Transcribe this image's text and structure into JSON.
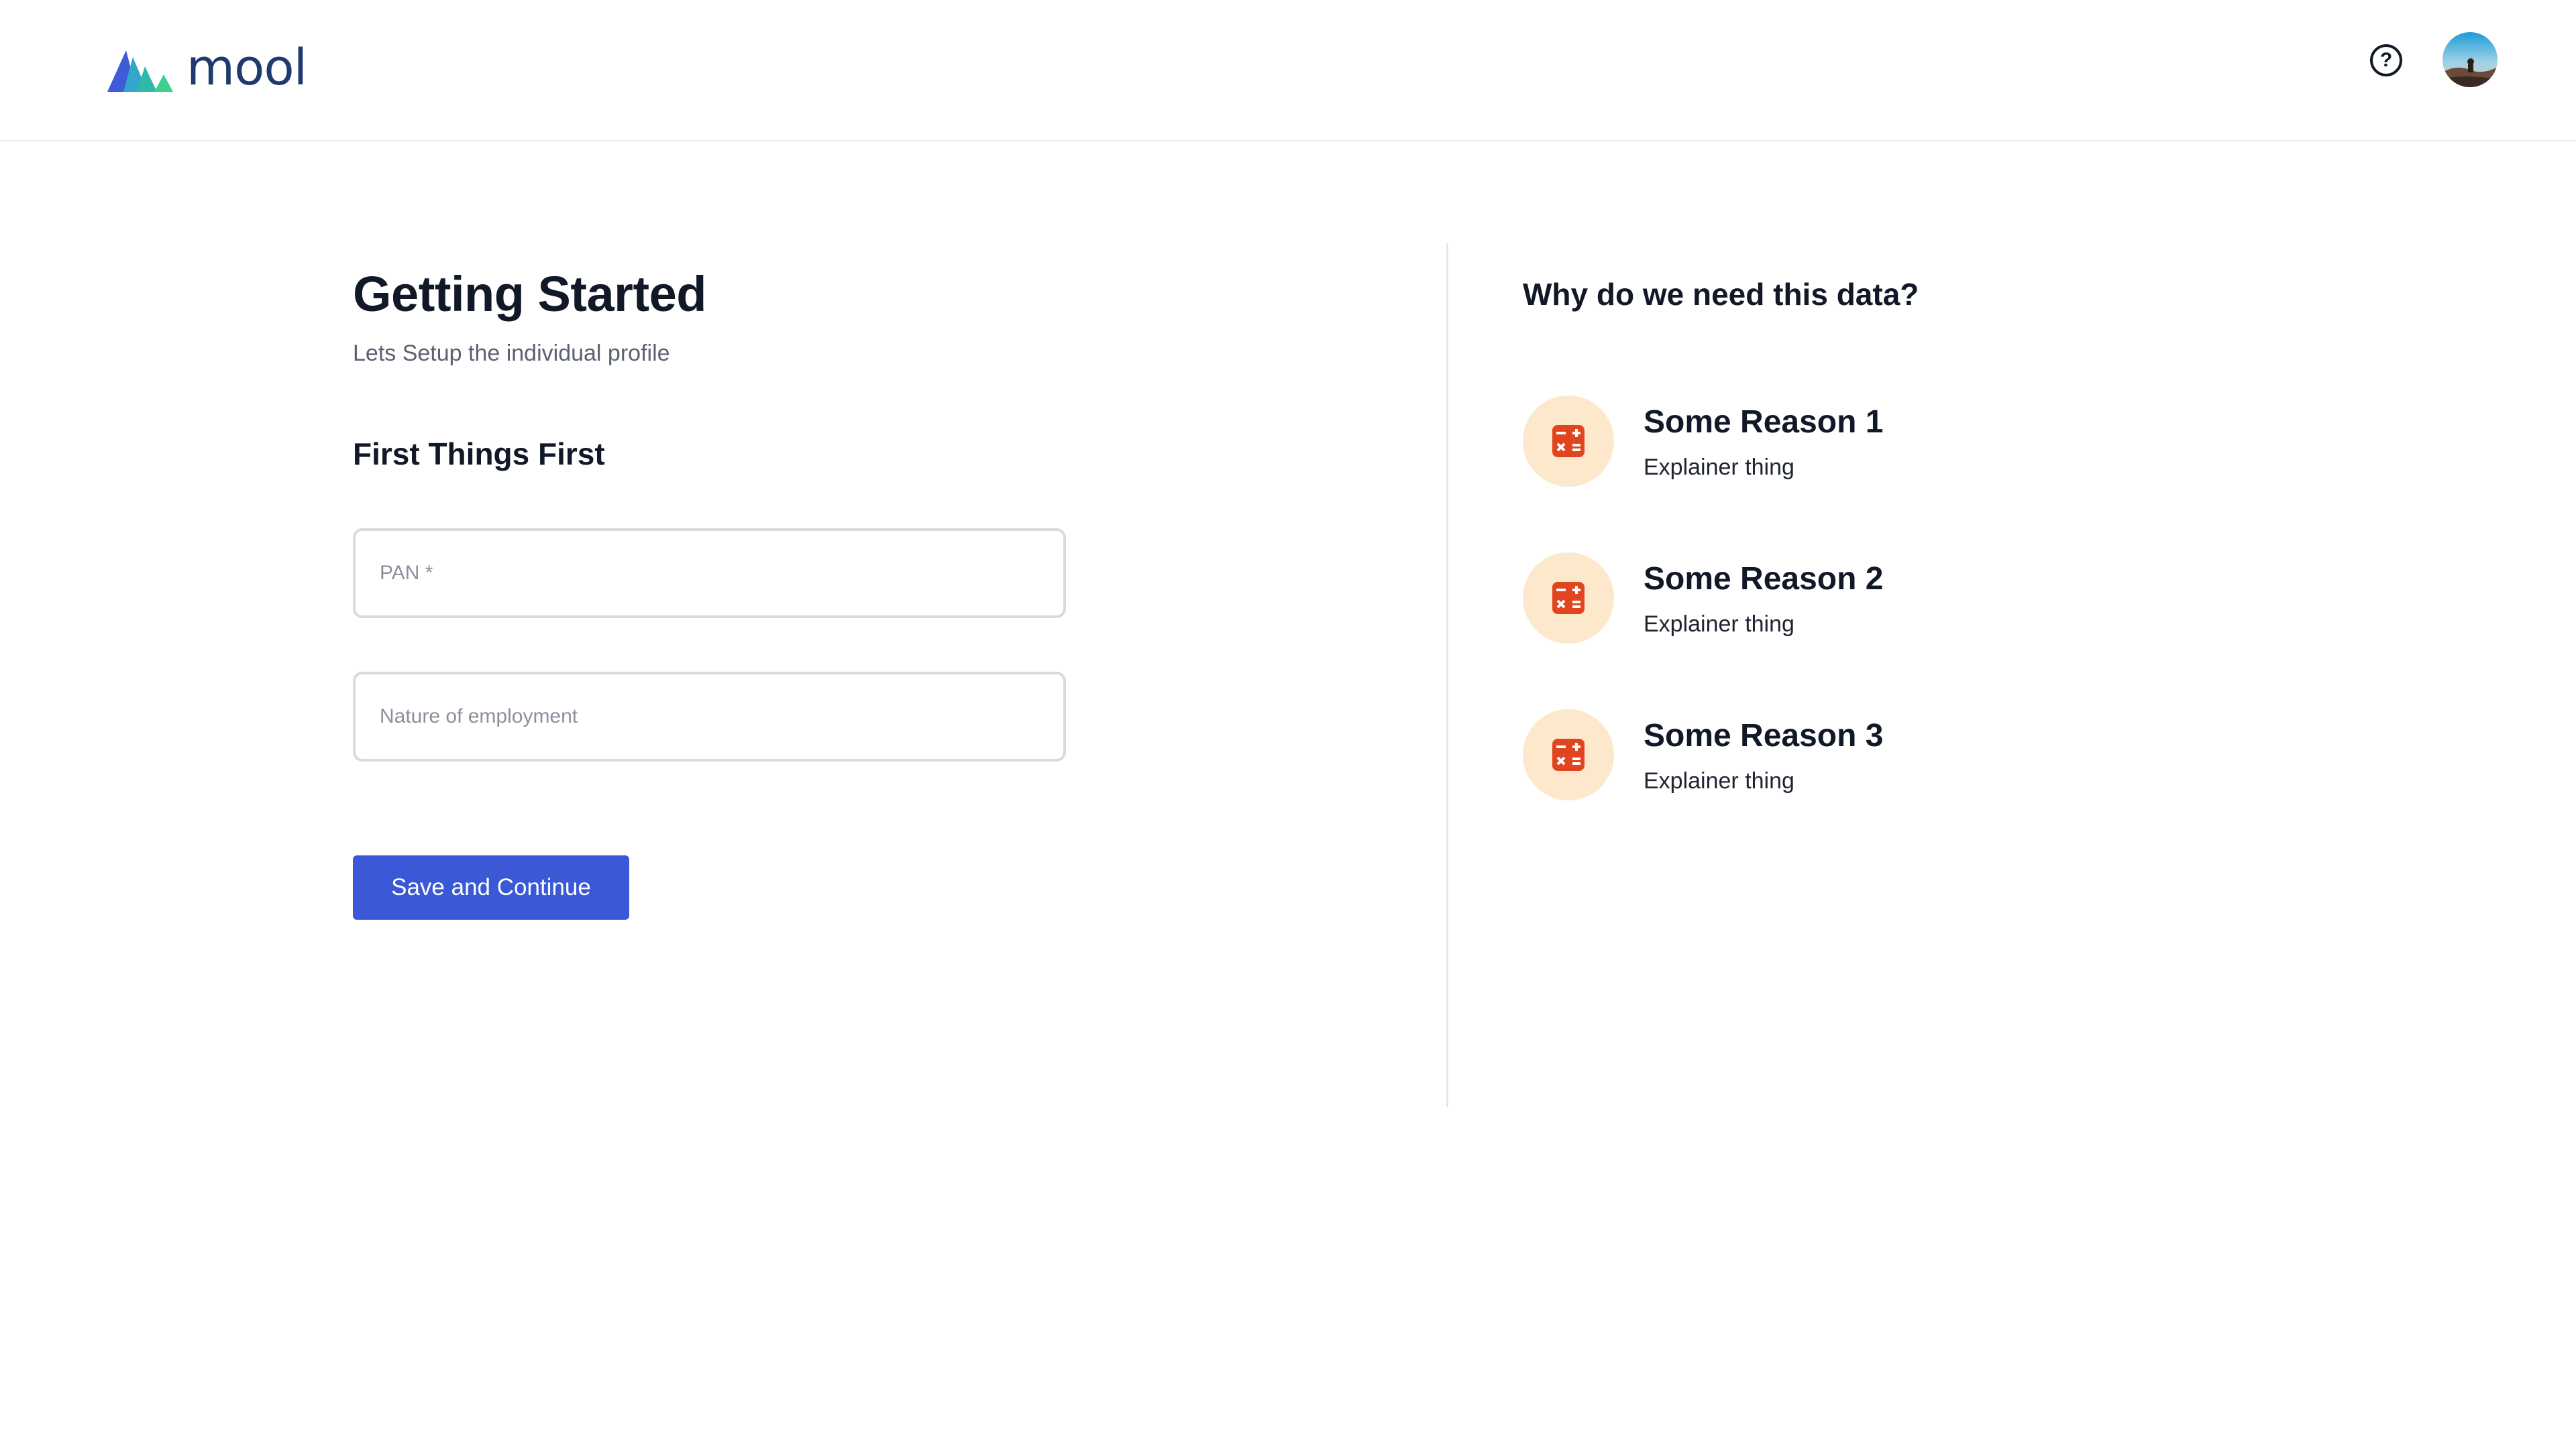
{
  "header": {
    "logo_text": "mool",
    "help_icon": "question-circle-icon",
    "avatar_icon": "user-avatar"
  },
  "main": {
    "title": "Getting Started",
    "subtitle": "Lets Setup the individual profile",
    "section_title": "First Things First",
    "fields": {
      "pan_placeholder": "PAN *",
      "pan_value": "",
      "employment_placeholder": "Nature of employment",
      "employment_value": ""
    },
    "save_button_label": "Save and Continue"
  },
  "sidebar": {
    "title": "Why do we need this data?",
    "reasons": [
      {
        "title": "Some Reason 1",
        "description": "Explainer thing",
        "icon": "calculator-icon"
      },
      {
        "title": "Some Reason 2",
        "description": "Explainer thing",
        "icon": "calculator-icon"
      },
      {
        "title": "Some Reason 3",
        "description": "Explainer thing",
        "icon": "calculator-icon"
      }
    ]
  },
  "colors": {
    "primary": "#3b58d6",
    "logo_text": "#1e3a6e",
    "icon_bg": "#fde8cc",
    "icon_fg": "#e0451f",
    "logo_blue": "#3f5bd8",
    "logo_teal": "#2fb9a8",
    "logo_green": "#3ed08f"
  }
}
